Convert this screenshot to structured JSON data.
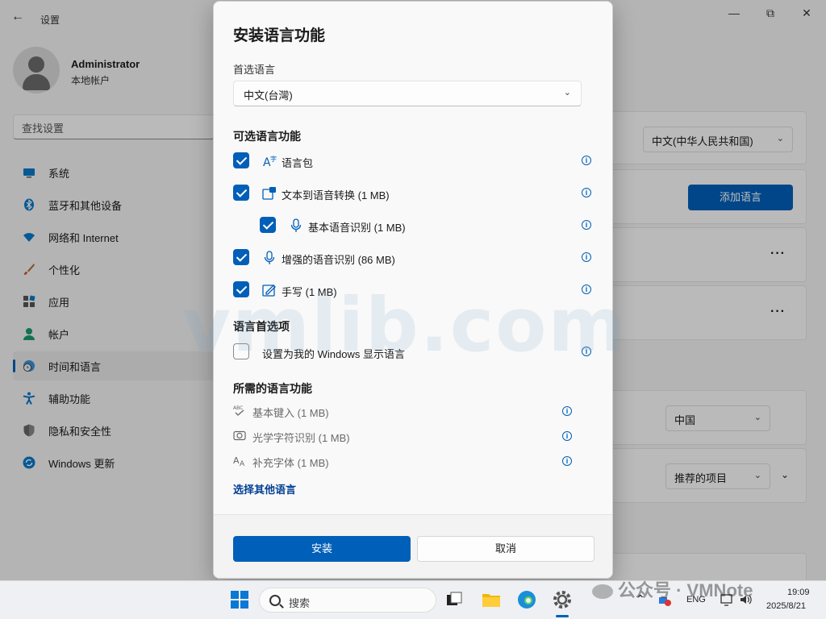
{
  "window": {
    "title": "设置",
    "back_icon": "back-arrow-icon",
    "controls": [
      "minimize-icon",
      "maximize-icon",
      "close-icon"
    ]
  },
  "user": {
    "name": "Administrator",
    "account_type": "本地帐户"
  },
  "search": {
    "placeholder": "查找设置"
  },
  "sidebar": {
    "items": [
      {
        "label": "系统",
        "icon": "system-icon",
        "active": false
      },
      {
        "label": "蓝牙和其他设备",
        "icon": "bluetooth-icon",
        "active": false
      },
      {
        "label": "网络和 Internet",
        "icon": "wifi-icon",
        "active": false
      },
      {
        "label": "个性化",
        "icon": "brush-icon",
        "active": false
      },
      {
        "label": "应用",
        "icon": "apps-icon",
        "active": false
      },
      {
        "label": "帐户",
        "icon": "account-icon",
        "active": false
      },
      {
        "label": "时间和语言",
        "icon": "globe-clock-icon",
        "active": true
      },
      {
        "label": "辅助功能",
        "icon": "accessibility-icon",
        "active": false
      },
      {
        "label": "隐私和安全性",
        "icon": "shield-icon",
        "active": false
      },
      {
        "label": "Windows 更新",
        "icon": "update-icon",
        "active": false
      }
    ]
  },
  "background": {
    "display_language": "中文(中华人民共和国)",
    "add_language_button": "添加语言",
    "more_label": "···",
    "region": "中国",
    "regional_format": "推荐的项目"
  },
  "dialog": {
    "title": "安装语言功能",
    "preferred_language_label": "首选语言",
    "preferred_language_value": "中文(台灣)",
    "optional_section": "可选语言功能",
    "optional_features": [
      {
        "label": "语言包",
        "checked": true,
        "icon": "language-pack-icon",
        "indent": false
      },
      {
        "label": "文本到语音转换 (1 MB)",
        "checked": true,
        "icon": "text-to-speech-icon",
        "indent": false
      },
      {
        "label": "基本语音识别 (1 MB)",
        "checked": true,
        "icon": "microphone-icon",
        "indent": true
      },
      {
        "label": "增强的语音识别 (86 MB)",
        "checked": true,
        "icon": "microphone-icon",
        "indent": false
      },
      {
        "label": "手写 (1 MB)",
        "checked": true,
        "icon": "handwriting-icon",
        "indent": false
      }
    ],
    "preferences_section": "语言首选项",
    "preference_option": {
      "label": "设置为我的 Windows 显示语言",
      "checked": false
    },
    "required_section": "所需的语言功能",
    "required_features": [
      {
        "label": "基本键入 (1 MB)",
        "icon": "spellcheck-icon"
      },
      {
        "label": "光学字符识别 (1 MB)",
        "icon": "camera-icon"
      },
      {
        "label": "补充字体 (1 MB)",
        "icon": "font-icon"
      }
    ],
    "choose_other_link": "选择其他语言",
    "install_button": "安装",
    "cancel_button": "取消"
  },
  "watermark": "vmlib.com",
  "wechat_mark": "公众号 · VMNote",
  "taskbar": {
    "search_placeholder": "搜索",
    "tray_lang": "ENG",
    "time": "19:09",
    "date": "2025/8/21"
  },
  "colors": {
    "accent": "#005fb8",
    "link": "#003e92"
  }
}
